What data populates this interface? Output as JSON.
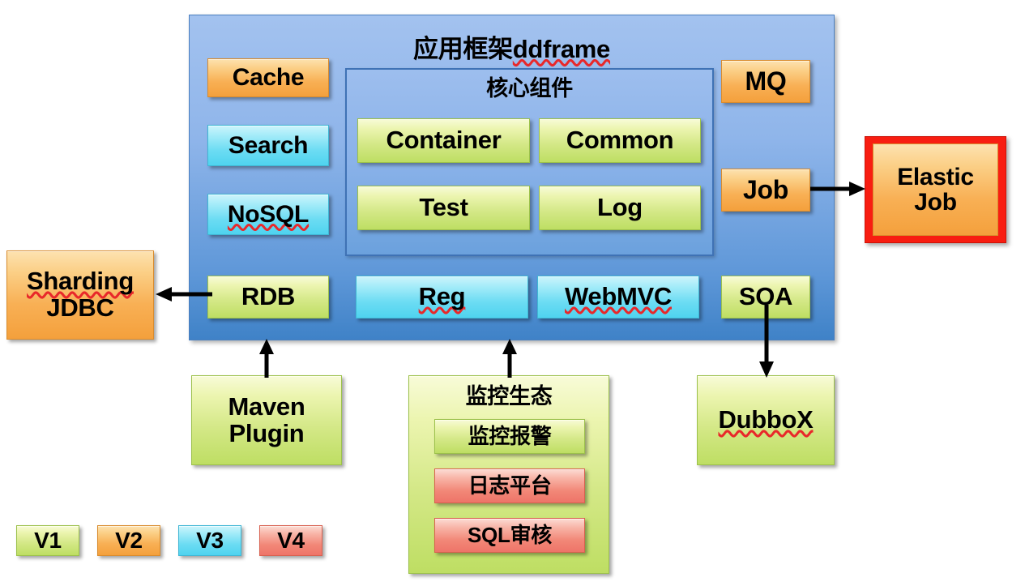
{
  "diagram": {
    "title": "应用框架ddframe",
    "title_plain": "应用框架",
    "title_spell": "ddframe",
    "core_group_title": "核心组件"
  },
  "colors": {
    "panel_blue_top": "#a3c2ef",
    "panel_blue_bottom": "#3f82c7",
    "core_blue": "#8ab2e9",
    "green": "#c8e271",
    "orange": "#f8b055",
    "cyan": "#6cdcf3",
    "red": "#f28878",
    "red_frame": "#f81d11",
    "text": "#000000",
    "spell_underline": "#e8282a"
  },
  "left_column": [
    {
      "label": "Cache",
      "color": "orange",
      "spell": false
    },
    {
      "label": "Search",
      "color": "cyan",
      "spell": false
    },
    {
      "label": "NoSQL",
      "color": "cyan",
      "spell": true
    }
  ],
  "core_components": [
    {
      "label": "Container",
      "color": "green"
    },
    {
      "label": "Common",
      "color": "green"
    },
    {
      "label": "Test",
      "color": "green"
    },
    {
      "label": "Log",
      "color": "green"
    }
  ],
  "right_column": [
    {
      "label": "MQ",
      "color": "orange"
    },
    {
      "label": "Job",
      "color": "orange"
    }
  ],
  "bottom_row": [
    {
      "label": "RDB",
      "color": "green",
      "spell": false
    },
    {
      "label": "Reg",
      "color": "cyan",
      "spell": true
    },
    {
      "label": "WebMVC",
      "color": "cyan",
      "spell": true
    },
    {
      "label": "SOA",
      "color": "green",
      "spell": false
    }
  ],
  "external": {
    "sharding_jdbc_line1": "Sharding",
    "sharding_jdbc_line2": "JDBC",
    "elastic_job_line1": "Elastic",
    "elastic_job_line2": "Job",
    "maven_plugin_line1": "Maven",
    "maven_plugin_line2": "Plugin",
    "dubbox": "DubboX"
  },
  "monitor_group": {
    "title": "监控生态",
    "items": [
      {
        "label": "监控报警",
        "color": "green"
      },
      {
        "label": "日志平台",
        "color": "red"
      },
      {
        "label": "SQL审核",
        "color": "red"
      }
    ]
  },
  "legend": [
    {
      "label": "V1",
      "color": "green"
    },
    {
      "label": "V2",
      "color": "orange"
    },
    {
      "label": "V3",
      "color": "cyan"
    },
    {
      "label": "V4",
      "color": "red"
    }
  ]
}
